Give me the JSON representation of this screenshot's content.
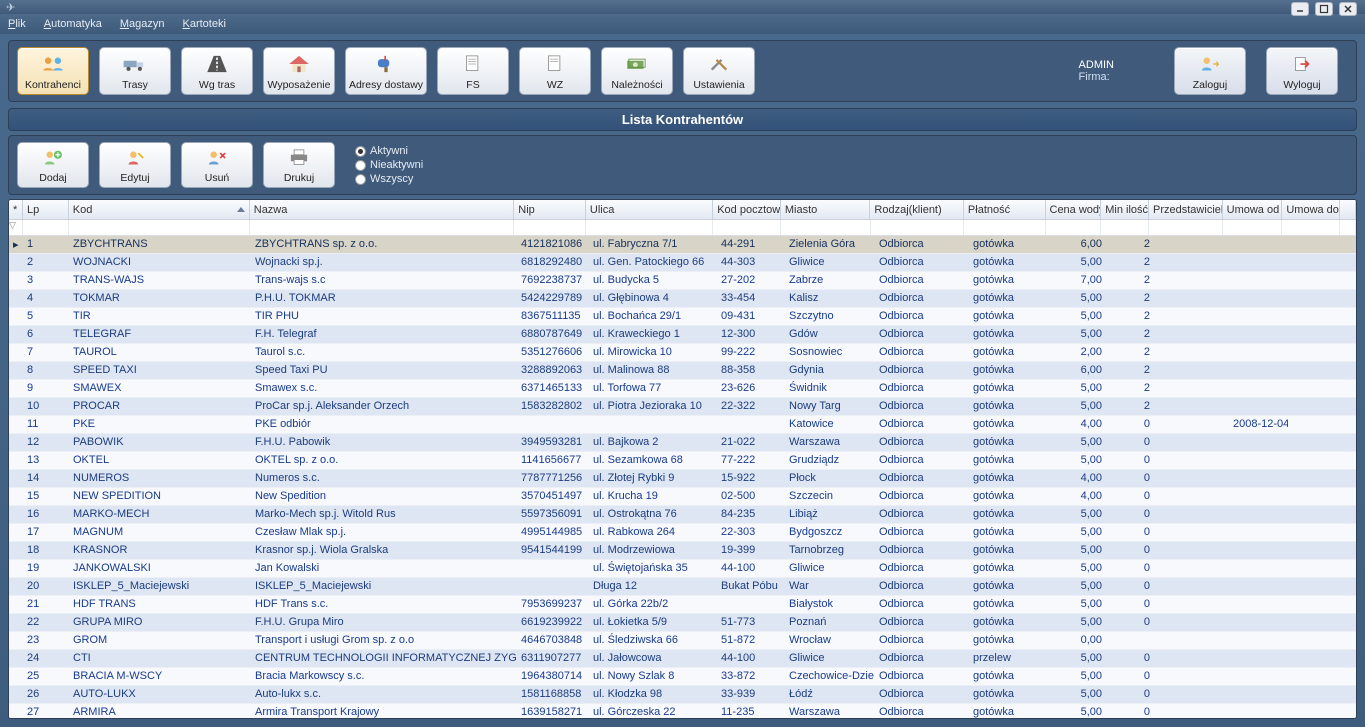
{
  "menu": {
    "plik": "Plik",
    "automatyka": "Automatyka",
    "magazyn": "Magazyn",
    "kartoteki": "Kartoteki"
  },
  "toolbar": {
    "kontrahenci": "Kontrahenci",
    "trasy": "Trasy",
    "wgtras": "Wg tras",
    "wyposazenie": "Wyposażenie",
    "adresy": "Adresy dostawy",
    "fs": "FS",
    "wz": "WZ",
    "naleznosci": "Należności",
    "ustawienia": "Ustawienia",
    "zaloguj": "Zaloguj",
    "wyloguj": "Wyloguj",
    "firma_label": "Firma:",
    "admin": "ADMIN"
  },
  "panel_title": "Lista Kontrahentów",
  "sub": {
    "dodaj": "Dodaj",
    "edytuj": "Edytuj",
    "usun": "Usuń",
    "drukuj": "Drukuj",
    "aktywni": "Aktywni",
    "nieaktywni": "Nieaktywni",
    "wszyscy": "Wszyscy"
  },
  "cols": [
    "",
    "Lp",
    "Kod",
    "Nazwa",
    "Nip",
    "Ulica",
    "Kod pocztow",
    "Miasto",
    "Rodzaj(klient)",
    "Płatność",
    "Cena wody",
    "Min ilość",
    "Przedstawiciel",
    "Umowa od",
    "Umowa do"
  ],
  "rows": [
    {
      "lp": 1,
      "kod": "ZBYCHTRANS",
      "nazwa": "ZBYCHTRANS sp. z o.o.",
      "nip": "4121821086",
      "ulica": "ul. Fabryczna 7/1",
      "kp": "44-291",
      "miasto": "Zielenia Góra",
      "rodzaj": "Odbiorca",
      "plat": "gotówka",
      "cena": "6,00",
      "min": "2",
      "przed": "",
      "uod": "",
      "udo": ""
    },
    {
      "lp": 2,
      "kod": "WOJNACKI",
      "nazwa": "Wojnacki sp.j.",
      "nip": "6818292480",
      "ulica": "ul. Gen. Patockiego 66",
      "kp": "44-303",
      "miasto": "Gliwice",
      "rodzaj": "Odbiorca",
      "plat": "gotówka",
      "cena": "5,00",
      "min": "2",
      "przed": "",
      "uod": "",
      "udo": ""
    },
    {
      "lp": 3,
      "kod": "TRANS-WAJS",
      "nazwa": "Trans-wajs s.c",
      "nip": "7692238737",
      "ulica": "ul. Budycka 5",
      "kp": "27-202",
      "miasto": "Zabrze",
      "rodzaj": "Odbiorca",
      "plat": "gotówka",
      "cena": "7,00",
      "min": "2",
      "przed": "",
      "uod": "",
      "udo": ""
    },
    {
      "lp": 4,
      "kod": "TOKMAR",
      "nazwa": "P.H.U. TOKMAR",
      "nip": "5424229789",
      "ulica": "ul. Głębinowa 4",
      "kp": "33-454",
      "miasto": "Kalisz",
      "rodzaj": "Odbiorca",
      "plat": "gotówka",
      "cena": "5,00",
      "min": "2",
      "przed": "",
      "uod": "",
      "udo": ""
    },
    {
      "lp": 5,
      "kod": "TIR",
      "nazwa": "TIR PHU",
      "nip": "8367511135",
      "ulica": "ul. Bochańca 29/1",
      "kp": "09-431",
      "miasto": "Szczytno",
      "rodzaj": "Odbiorca",
      "plat": "gotówka",
      "cena": "5,00",
      "min": "2",
      "przed": "",
      "uod": "",
      "udo": ""
    },
    {
      "lp": 6,
      "kod": "TELEGRAF",
      "nazwa": "F.H. Telegraf",
      "nip": "6880787649",
      "ulica": "ul. Kraweckiego 1",
      "kp": "12-300",
      "miasto": "Gdów",
      "rodzaj": "Odbiorca",
      "plat": "gotówka",
      "cena": "5,00",
      "min": "2",
      "przed": "",
      "uod": "",
      "udo": ""
    },
    {
      "lp": 7,
      "kod": "TAUROL",
      "nazwa": "Taurol s.c.",
      "nip": "5351276606",
      "ulica": "ul. Mirowicka 10",
      "kp": "99-222",
      "miasto": "Sosnowiec",
      "rodzaj": "Odbiorca",
      "plat": "gotówka",
      "cena": "2,00",
      "min": "2",
      "przed": "",
      "uod": "",
      "udo": ""
    },
    {
      "lp": 8,
      "kod": "SPEED TAXI",
      "nazwa": "Speed Taxi PU",
      "nip": "3288892063",
      "ulica": "ul. Malinowa 88",
      "kp": "88-358",
      "miasto": "Gdynia",
      "rodzaj": "Odbiorca",
      "plat": "gotówka",
      "cena": "6,00",
      "min": "2",
      "przed": "",
      "uod": "",
      "udo": ""
    },
    {
      "lp": 9,
      "kod": "SMAWEX",
      "nazwa": "Smawex s.c.",
      "nip": "6371465133",
      "ulica": "ul. Torfowa 77",
      "kp": "23-626",
      "miasto": "Świdnik",
      "rodzaj": "Odbiorca",
      "plat": "gotówka",
      "cena": "5,00",
      "min": "2",
      "przed": "",
      "uod": "",
      "udo": ""
    },
    {
      "lp": 10,
      "kod": "PROCAR",
      "nazwa": "ProCar sp.j. Aleksander Orzech",
      "nip": "1583282802",
      "ulica": "ul. Piotra Jezioraka 10",
      "kp": "22-322",
      "miasto": "Nowy Targ",
      "rodzaj": "Odbiorca",
      "plat": "gotówka",
      "cena": "5,00",
      "min": "2",
      "przed": "",
      "uod": "",
      "udo": ""
    },
    {
      "lp": 11,
      "kod": "PKE",
      "nazwa": "PKE odbiór",
      "nip": "",
      "ulica": "",
      "kp": "",
      "miasto": "Katowice",
      "rodzaj": "Odbiorca",
      "plat": "gotówka",
      "cena": "4,00",
      "min": "0",
      "przed": "",
      "uod": "2008-12-04",
      "udo": ""
    },
    {
      "lp": 12,
      "kod": "PABOWIK",
      "nazwa": "F.H.U. Pabowik",
      "nip": "3949593281",
      "ulica": "ul. Bajkowa 2",
      "kp": "21-022",
      "miasto": "Warszawa",
      "rodzaj": "Odbiorca",
      "plat": "gotówka",
      "cena": "5,00",
      "min": "0",
      "przed": "",
      "uod": "",
      "udo": ""
    },
    {
      "lp": 13,
      "kod": "OKTEL",
      "nazwa": "OKTEL sp. z o.o.",
      "nip": "1141656677",
      "ulica": "ul. Sezamkowa 68",
      "kp": "77-222",
      "miasto": "Grudziądz",
      "rodzaj": "Odbiorca",
      "plat": "gotówka",
      "cena": "5,00",
      "min": "0",
      "przed": "",
      "uod": "",
      "udo": ""
    },
    {
      "lp": 14,
      "kod": "NUMEROS",
      "nazwa": "Numeros s.c.",
      "nip": "7787771256",
      "ulica": "ul. Złotej Rybki 9",
      "kp": "15-922",
      "miasto": "Płock",
      "rodzaj": "Odbiorca",
      "plat": "gotówka",
      "cena": "4,00",
      "min": "0",
      "przed": "",
      "uod": "",
      "udo": ""
    },
    {
      "lp": 15,
      "kod": "NEW SPEDITION",
      "nazwa": "New Spedition",
      "nip": "3570451497",
      "ulica": "ul. Krucha 19",
      "kp": "02-500",
      "miasto": "Szczecin",
      "rodzaj": "Odbiorca",
      "plat": "gotówka",
      "cena": "4,00",
      "min": "0",
      "przed": "",
      "uod": "",
      "udo": ""
    },
    {
      "lp": 16,
      "kod": "MARKO-MECH",
      "nazwa": "Marko-Mech sp.j. Witold Rus",
      "nip": "5597356091",
      "ulica": "ul. Ostrokątna 76",
      "kp": "84-235",
      "miasto": "Libiąż",
      "rodzaj": "Odbiorca",
      "plat": "gotówka",
      "cena": "5,00",
      "min": "0",
      "przed": "",
      "uod": "",
      "udo": ""
    },
    {
      "lp": 17,
      "kod": "MAGNUM",
      "nazwa": "Czesław Mlak sp.j.",
      "nip": "4995144985",
      "ulica": "ul. Rabkowa 264",
      "kp": "22-303",
      "miasto": "Bydgoszcz",
      "rodzaj": "Odbiorca",
      "plat": "gotówka",
      "cena": "5,00",
      "min": "0",
      "przed": "",
      "uod": "",
      "udo": ""
    },
    {
      "lp": 18,
      "kod": "KRASNOR",
      "nazwa": "Krasnor sp.j. Wiola Gralska",
      "nip": "9541544199",
      "ulica": "ul. Modrzewiowa",
      "kp": "19-399",
      "miasto": "Tarnobrzeg",
      "rodzaj": "Odbiorca",
      "plat": "gotówka",
      "cena": "5,00",
      "min": "0",
      "przed": "",
      "uod": "",
      "udo": ""
    },
    {
      "lp": 19,
      "kod": "JANKOWALSKI",
      "nazwa": "Jan Kowalski",
      "nip": "",
      "ulica": "ul. Świętojańska 35",
      "kp": "44-100",
      "miasto": "Gliwice",
      "rodzaj": "Odbiorca",
      "plat": "gotówka",
      "cena": "5,00",
      "min": "0",
      "przed": "",
      "uod": "",
      "udo": ""
    },
    {
      "lp": 20,
      "kod": "ISKLEP_5_Maciejewski",
      "nazwa": "ISKLEP_5_Maciejewski",
      "nip": "",
      "ulica": "Długa 12",
      "kp": "Bukat Póbu",
      "miasto": "War",
      "rodzaj": "Odbiorca",
      "plat": "gotówka",
      "cena": "5,00",
      "min": "0",
      "przed": "",
      "uod": "",
      "udo": ""
    },
    {
      "lp": 21,
      "kod": "HDF TRANS",
      "nazwa": "HDF Trans s.c.",
      "nip": "7953699237",
      "ulica": "ul. Górka 22b/2",
      "kp": "",
      "miasto": "Białystok",
      "rodzaj": "Odbiorca",
      "plat": "gotówka",
      "cena": "5,00",
      "min": "0",
      "przed": "",
      "uod": "",
      "udo": ""
    },
    {
      "lp": 22,
      "kod": "GRUPA MIRO",
      "nazwa": "F.H.U. Grupa Miro",
      "nip": "6619239922",
      "ulica": "ul. Łokietka 5/9",
      "kp": "51-773",
      "miasto": "Poznań",
      "rodzaj": "Odbiorca",
      "plat": "gotówka",
      "cena": "5,00",
      "min": "0",
      "przed": "",
      "uod": "",
      "udo": ""
    },
    {
      "lp": 23,
      "kod": "GROM",
      "nazwa": "Transport i usługi Grom sp. z o.o",
      "nip": "4646703848",
      "ulica": "ul. Śledziwska 66",
      "kp": "51-872",
      "miasto": "Wrocław",
      "rodzaj": "Odbiorca",
      "plat": "gotówka",
      "cena": "0,00",
      "min": "",
      "przed": "",
      "uod": "",
      "udo": ""
    },
    {
      "lp": 24,
      "kod": "CTI",
      "nazwa": "CENTRUM TECHNOLOGII INFORMATYCZNEJ ZYGM",
      "nip": "6311907277",
      "ulica": "ul. Jałowcowa",
      "kp": "44-100",
      "miasto": "Gliwice",
      "rodzaj": "Odbiorca",
      "plat": "przelew",
      "cena": "5,00",
      "min": "0",
      "przed": "",
      "uod": "",
      "udo": ""
    },
    {
      "lp": 25,
      "kod": "BRACIA M-WSCY",
      "nazwa": "Bracia Markowscy s.c.",
      "nip": "1964380714",
      "ulica": "ul. Nowy Szlak 8",
      "kp": "33-872",
      "miasto": "Czechowice-Dziec",
      "rodzaj": "Odbiorca",
      "plat": "gotówka",
      "cena": "5,00",
      "min": "0",
      "przed": "",
      "uod": "",
      "udo": ""
    },
    {
      "lp": 26,
      "kod": "AUTO-LUKX",
      "nazwa": "Auto-lukx s.c.",
      "nip": "1581168858",
      "ulica": "ul. Kłodzka 98",
      "kp": "33-939",
      "miasto": "Łódź",
      "rodzaj": "Odbiorca",
      "plat": "gotówka",
      "cena": "5,00",
      "min": "0",
      "przed": "",
      "uod": "",
      "udo": ""
    },
    {
      "lp": 27,
      "kod": "ARMIRA",
      "nazwa": "Armira Transport Krajowy",
      "nip": "1639158271",
      "ulica": "ul. Górczeska 22",
      "kp": "11-235",
      "miasto": "Warszawa",
      "rodzaj": "Odbiorca",
      "plat": "gotówka",
      "cena": "5,00",
      "min": "0",
      "przed": "",
      "uod": "",
      "udo": ""
    }
  ]
}
